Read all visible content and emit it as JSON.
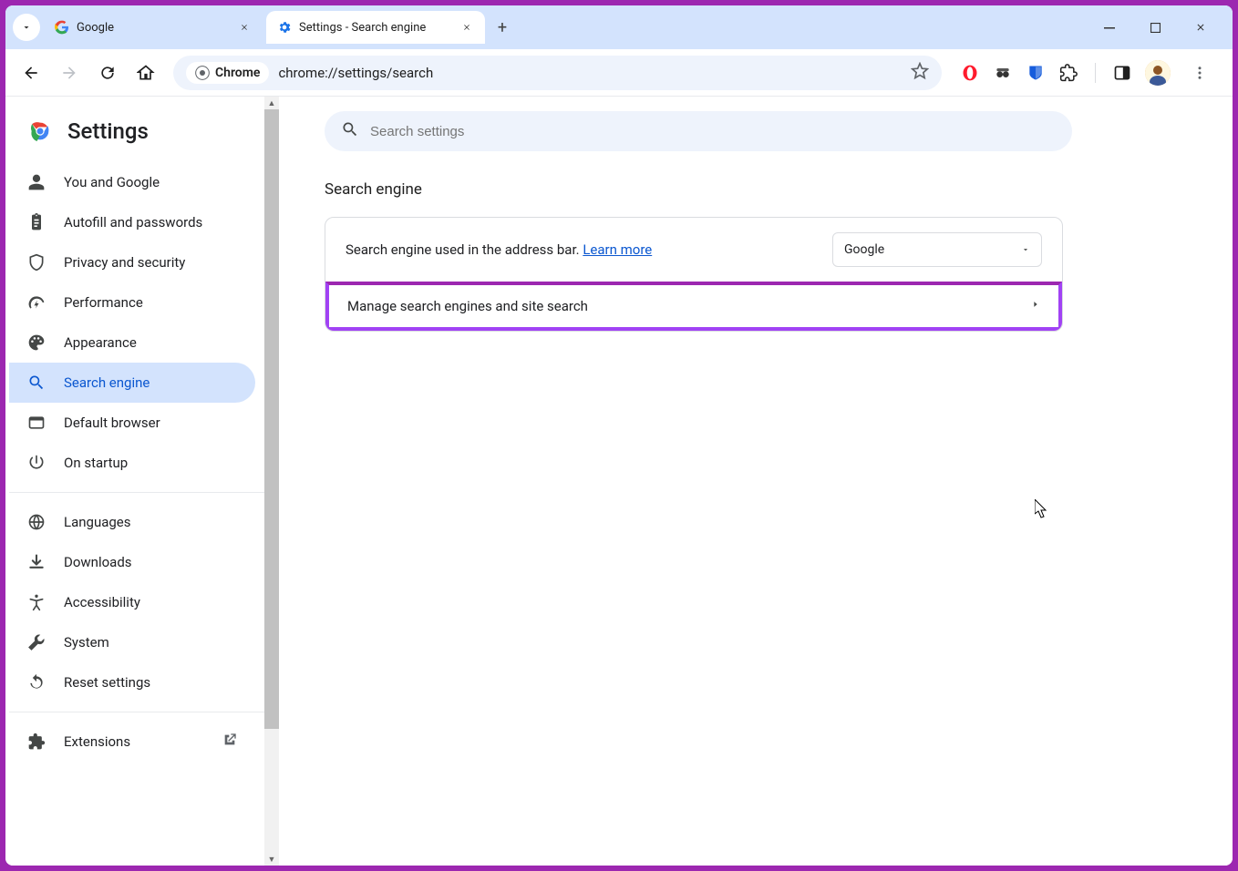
{
  "tabs": [
    {
      "title": "Google",
      "active": false
    },
    {
      "title": "Settings - Search engine",
      "active": true
    }
  ],
  "toolbar": {
    "chip_label": "Chrome",
    "url": "chrome://settings/search"
  },
  "sidebar": {
    "title": "Settings",
    "groups": [
      [
        {
          "icon": "person",
          "label": "You and Google"
        },
        {
          "icon": "clipboard",
          "label": "Autofill and passwords"
        },
        {
          "icon": "shield",
          "label": "Privacy and security"
        },
        {
          "icon": "speed",
          "label": "Performance"
        },
        {
          "icon": "palette",
          "label": "Appearance"
        },
        {
          "icon": "search",
          "label": "Search engine",
          "selected": true
        },
        {
          "icon": "browser",
          "label": "Default browser"
        },
        {
          "icon": "power",
          "label": "On startup"
        }
      ],
      [
        {
          "icon": "globe",
          "label": "Languages"
        },
        {
          "icon": "download",
          "label": "Downloads"
        },
        {
          "icon": "accessibility",
          "label": "Accessibility"
        },
        {
          "icon": "wrench",
          "label": "System"
        },
        {
          "icon": "restore",
          "label": "Reset settings"
        }
      ],
      [
        {
          "icon": "extension",
          "label": "Extensions",
          "external": true
        }
      ]
    ]
  },
  "main": {
    "search_placeholder": "Search settings",
    "section_title": "Search engine",
    "row1_text": "Search engine used in the address bar. ",
    "row1_link": "Learn more",
    "dropdown_value": "Google",
    "row2_text": "Manage search engines and site search"
  }
}
